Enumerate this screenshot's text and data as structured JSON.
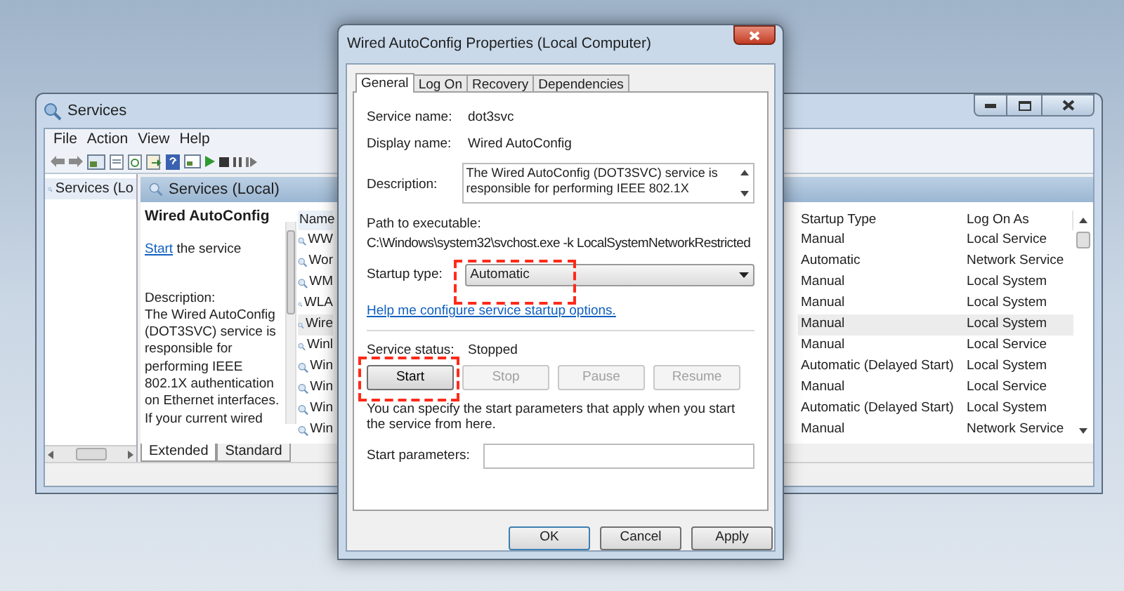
{
  "services_window": {
    "title": "Services",
    "menu": [
      "File",
      "Action",
      "View",
      "Help"
    ],
    "tree": [
      {
        "label": "Services (Lo",
        "selected": true
      }
    ],
    "pane_header": "Services (Local)",
    "detail": {
      "title": "Wired AutoConfig",
      "link": "Start",
      "link_rest": " the service",
      "description_label": "Description:",
      "description": "The Wired AutoConfig (DOT3SVC) service is responsible for performing IEEE 802.1X authentication on Ethernet interfaces. If your current wired"
    },
    "columns": [
      "Name",
      "Startup Type",
      "Log On As"
    ],
    "rows": [
      {
        "name": "WW",
        "startup_type": "Manual",
        "log_on_as": "Local Service",
        "selected": false
      },
      {
        "name": "Wor",
        "startup_type": "Automatic",
        "log_on_as": "Network Service",
        "selected": false
      },
      {
        "name": "WM",
        "startup_type": "Manual",
        "log_on_as": "Local System",
        "selected": false
      },
      {
        "name": "WLA",
        "startup_type": "Manual",
        "log_on_as": "Local System",
        "selected": false
      },
      {
        "name": "Wire",
        "startup_type": "Manual",
        "log_on_as": "Local System",
        "selected": true
      },
      {
        "name": "Winl",
        "startup_type": "Manual",
        "log_on_as": "Local Service",
        "selected": false
      },
      {
        "name": "Win",
        "startup_type": "Automatic (Delayed Start)",
        "log_on_as": "Local System",
        "selected": false
      },
      {
        "name": "Win",
        "startup_type": "Manual",
        "log_on_as": "Local Service",
        "selected": false
      },
      {
        "name": "Win",
        "startup_type": "Automatic (Delayed Start)",
        "log_on_as": "Local System",
        "selected": false
      },
      {
        "name": "Win",
        "startup_type": "Manual",
        "log_on_as": "Network Service",
        "selected": false
      }
    ],
    "view_tabs": [
      {
        "label": "Extended",
        "selected": true
      },
      {
        "label": "Standard",
        "selected": false
      }
    ]
  },
  "dialog": {
    "title": "Wired AutoConfig Properties (Local Computer)",
    "tabs": [
      {
        "label": "General",
        "selected": true
      },
      {
        "label": "Log On",
        "selected": false
      },
      {
        "label": "Recovery",
        "selected": false
      },
      {
        "label": "Dependencies",
        "selected": false
      }
    ],
    "service_name_label": "Service name:",
    "service_name": "dot3svc",
    "display_name_label": "Display name:",
    "display_name": "Wired AutoConfig",
    "description_label": "Description:",
    "description": "The Wired AutoConfig (DOT3SVC) service is responsible for performing IEEE 802.1X",
    "path_label": "Path to executable:",
    "path": "C:\\Windows\\system32\\svchost.exe -k LocalSystemNetworkRestricted",
    "startup_type_label": "Startup type:",
    "startup_type": "Automatic",
    "help_link": "Help me configure service startup options.",
    "status_label": "Service status:",
    "status": "Stopped",
    "control_buttons": [
      {
        "label": "Start",
        "disabled": false,
        "highlighted": true
      },
      {
        "label": "Stop",
        "disabled": true,
        "highlighted": false
      },
      {
        "label": "Pause",
        "disabled": true,
        "highlighted": false
      },
      {
        "label": "Resume",
        "disabled": true,
        "highlighted": false
      }
    ],
    "params_note": "You can specify the start parameters that apply when you start the service from here.",
    "start_params_label": "Start parameters:",
    "buttons": [
      "OK",
      "Cancel",
      "Apply"
    ]
  }
}
